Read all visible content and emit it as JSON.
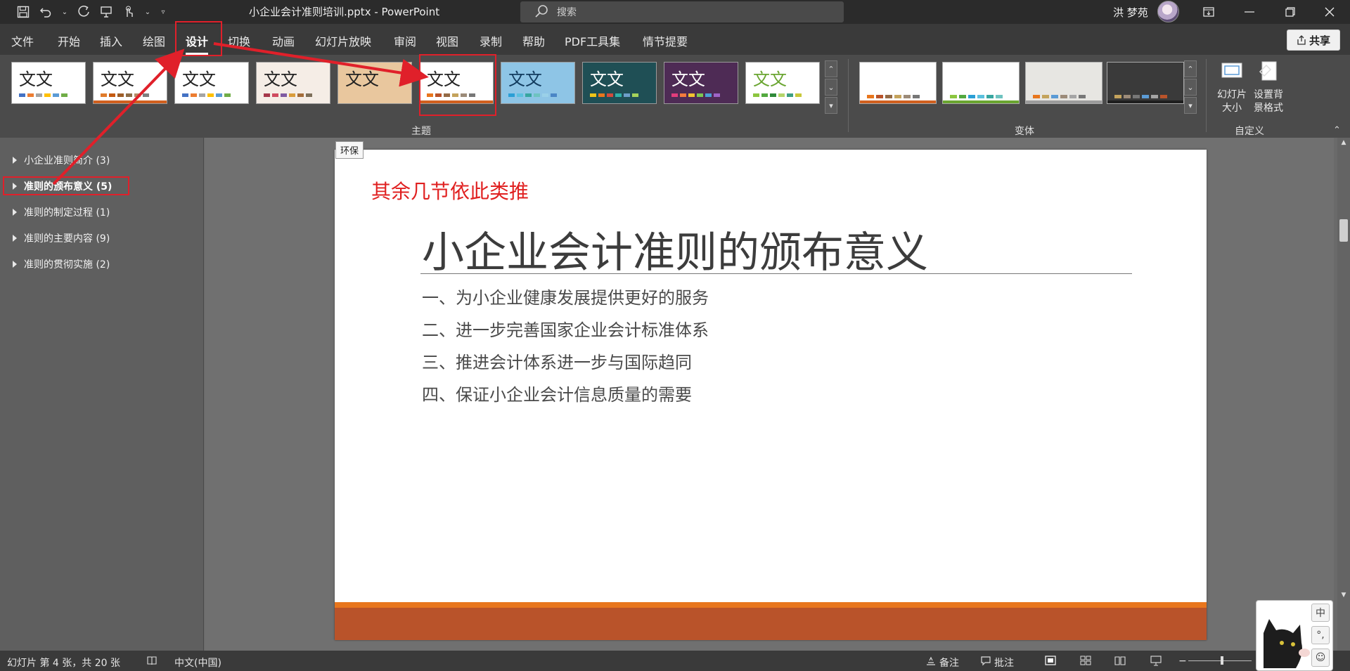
{
  "titlebar": {
    "doc_title": "小企业会计准则培训.pptx  -  PowerPoint",
    "search_placeholder": "搜索",
    "user_name": "洪 梦苑"
  },
  "ribbon_tabs": [
    "文件",
    "开始",
    "插入",
    "绘图",
    "设计",
    "切换",
    "动画",
    "幻灯片放映",
    "审阅",
    "视图",
    "录制",
    "帮助",
    "PDF工具集",
    "情节提要"
  ],
  "active_tab": "设计",
  "share_label": "共享",
  "themes": {
    "group_label": "主题",
    "items": [
      {
        "label": "文文",
        "bg": "#ffffff",
        "fg": "#222222",
        "line": "",
        "bars": [
          "#4472c4",
          "#ed7d31",
          "#a5a5a5",
          "#ffc000",
          "#5b9bd5",
          "#70ad47"
        ]
      },
      {
        "label": "文文",
        "bg": "#ffffff",
        "fg": "#222222",
        "line": "#d0601f",
        "bars": [
          "#e17b2a",
          "#c55a11",
          "#9e5e28",
          "#8c6d48",
          "#b38b66",
          "#7f7f7f"
        ]
      },
      {
        "label": "文文",
        "bg": "#ffffff",
        "fg": "#222222",
        "line": "",
        "bars": [
          "#4472c4",
          "#ed7d31",
          "#a5a5a5",
          "#ffc000",
          "#5b9bd5",
          "#70ad47"
        ]
      },
      {
        "label": "文文",
        "bg": "#f5ede6",
        "fg": "#222222",
        "line": "",
        "bars": [
          "#a5374a",
          "#cf4b5f",
          "#7f5aa2",
          "#d99c3b",
          "#a46c3a",
          "#7d6f5a"
        ]
      },
      {
        "label": "文文",
        "bg": "#e9c79e",
        "fg": "#222222",
        "line": "",
        "bars": []
      },
      {
        "label": "文文",
        "bg": "#ffffff",
        "fg": "#222222",
        "line": "#d0601f",
        "bars": [
          "#e8761d",
          "#b9532a",
          "#946a45",
          "#c4a35c",
          "#9c8b79",
          "#777777"
        ]
      },
      {
        "label": "文文",
        "bg": "#8ec5e6",
        "fg": "#123b5e",
        "line": "",
        "bars": [
          "#2a9fd6",
          "#5bc0de",
          "#37a6a0",
          "#6ec3c0",
          "#9ad0e8",
          "#4b86c6"
        ]
      },
      {
        "label": "文文",
        "bg": "#1f4f55",
        "fg": "#ffffff",
        "line": "",
        "bars": [
          "#f0c419",
          "#e8761d",
          "#d44a3c",
          "#2fb1a8",
          "#6d9ec9",
          "#a5d35b"
        ]
      },
      {
        "label": "文文",
        "bg": "#4e2b55",
        "fg": "#ffffff",
        "line": "",
        "bars": [
          "#e23c7c",
          "#f47a3d",
          "#f2c230",
          "#7ec850",
          "#4aa0d5",
          "#9e64c8"
        ]
      },
      {
        "label": "文文",
        "bg": "#ffffff",
        "fg": "#6aa531",
        "line": "",
        "bars": [
          "#8cc63f",
          "#53a93f",
          "#2f8a3a",
          "#b5d56a",
          "#3d9f82",
          "#c8c83a"
        ]
      }
    ]
  },
  "variants": {
    "group_label": "变体",
    "items": [
      {
        "bg": "#ffffff",
        "line": "#d0601f",
        "bars": [
          "#e8761d",
          "#b9532a",
          "#946a45",
          "#c4a35c",
          "#9c8b79",
          "#777777"
        ]
      },
      {
        "bg": "#ffffff",
        "line": "#6aa531",
        "bars": [
          "#8cc63f",
          "#53a93f",
          "#2a9fd6",
          "#5bc0de",
          "#37a6a0",
          "#6ec3c0"
        ]
      },
      {
        "bg": "#e7e6e2",
        "line": "#9c9c9c",
        "bars": [
          "#e8761d",
          "#c4a35c",
          "#5b9bd5",
          "#9c8b79",
          "#a5a5a5",
          "#777777"
        ]
      },
      {
        "bg": "#3a3a3a",
        "line": "#1e1e1e",
        "bars": [
          "#c4a35c",
          "#9c8b79",
          "#777777",
          "#5b9bd5",
          "#a5a5a5",
          "#b9532a"
        ]
      }
    ]
  },
  "customize": {
    "group_label": "自定义",
    "slide_size_label_1": "幻灯片",
    "slide_size_label_2": "大小",
    "format_bg_label_1": "设置背",
    "format_bg_label_2": "景格式"
  },
  "sections": [
    {
      "label": "小企业准则简介 (3)",
      "active": false
    },
    {
      "label": "准则的颁布意义 (5)",
      "active": true
    },
    {
      "label": "准则的制定过程 (1)",
      "active": false
    },
    {
      "label": "准则的主要内容 (9)",
      "active": false
    },
    {
      "label": "准则的贯彻实施 (2)",
      "active": false
    }
  ],
  "tooltip": "环保",
  "slide": {
    "annotation": "其余几节依此类推",
    "title": "小企业会计准则的颁布意义",
    "bullets": [
      "一、为小企业健康发展提供更好的服务",
      "二、进一步完善国家企业会计标准体系",
      "三、推进会计体系进一步与国际趋同",
      "四、保证小企业会计信息质量的需要"
    ]
  },
  "status": {
    "slide_counter": "幻灯片 第 4 张，共 20 张",
    "language": "中文(中国)",
    "notes_label": "备注",
    "comments_label": "批注"
  },
  "ime": {
    "mode": "中",
    "punct": "°,",
    "extra": "☺"
  },
  "colors": {
    "annotation_red": "#e0202a",
    "slide_band_orange": "#e8761d",
    "slide_band_rust": "#b9532a"
  }
}
